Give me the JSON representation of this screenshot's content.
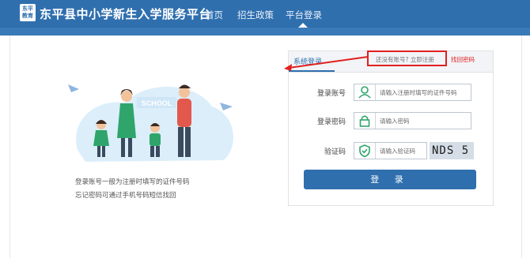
{
  "header": {
    "logo_text_line1": "东平",
    "logo_text_line2": "教育",
    "title": "东平县中小学新生入学服务平台",
    "nav": [
      {
        "label": "首页"
      },
      {
        "label": "招生政策"
      },
      {
        "label": "平台登录"
      }
    ]
  },
  "illustration": {
    "sign_text": "SCHOOL"
  },
  "tips": [
    "登录账号一般为注册时填写的证件号码",
    "忘记密码可通过手机号码短信找回"
  ],
  "login": {
    "panel_title": "系统登录",
    "register_link": "还没有账号? 立即注册",
    "find_password_link": "找回密码",
    "account_label": "登录账号",
    "account_placeholder": "请输入注册时填写的证件号码",
    "password_label": "登录密码",
    "password_placeholder": "请输入密码",
    "captcha_label": "验证码",
    "captcha_placeholder": "请输入验证码",
    "captcha_text": "NDS 5",
    "submit_label": "登 录"
  },
  "colors": {
    "brand_blue": "#2f6fae",
    "highlight_red": "#e02020"
  },
  "icons": {
    "account": "user-icon",
    "password": "lock-icon",
    "captcha": "shield-check-icon"
  }
}
